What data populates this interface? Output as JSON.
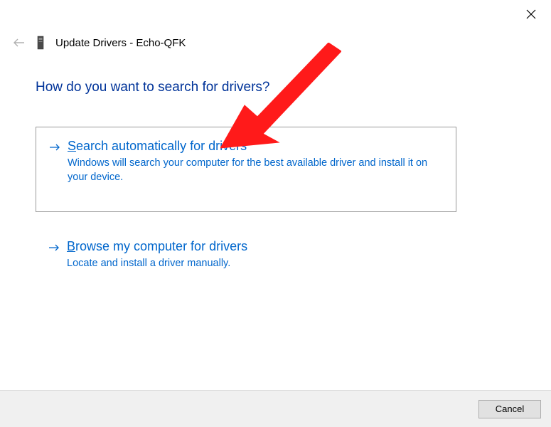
{
  "window": {
    "title": "Update Drivers - Echo-QFK"
  },
  "heading": "How do you want to search for drivers?",
  "options": [
    {
      "title_prefix": "S",
      "title_rest": "earch automatically for drivers",
      "description": "Windows will search your computer for the best available driver and install it on your device."
    },
    {
      "title_prefix": "B",
      "title_rest": "rowse my computer for drivers",
      "description": "Locate and install a driver manually."
    }
  ],
  "footer": {
    "cancel_label": "Cancel"
  }
}
